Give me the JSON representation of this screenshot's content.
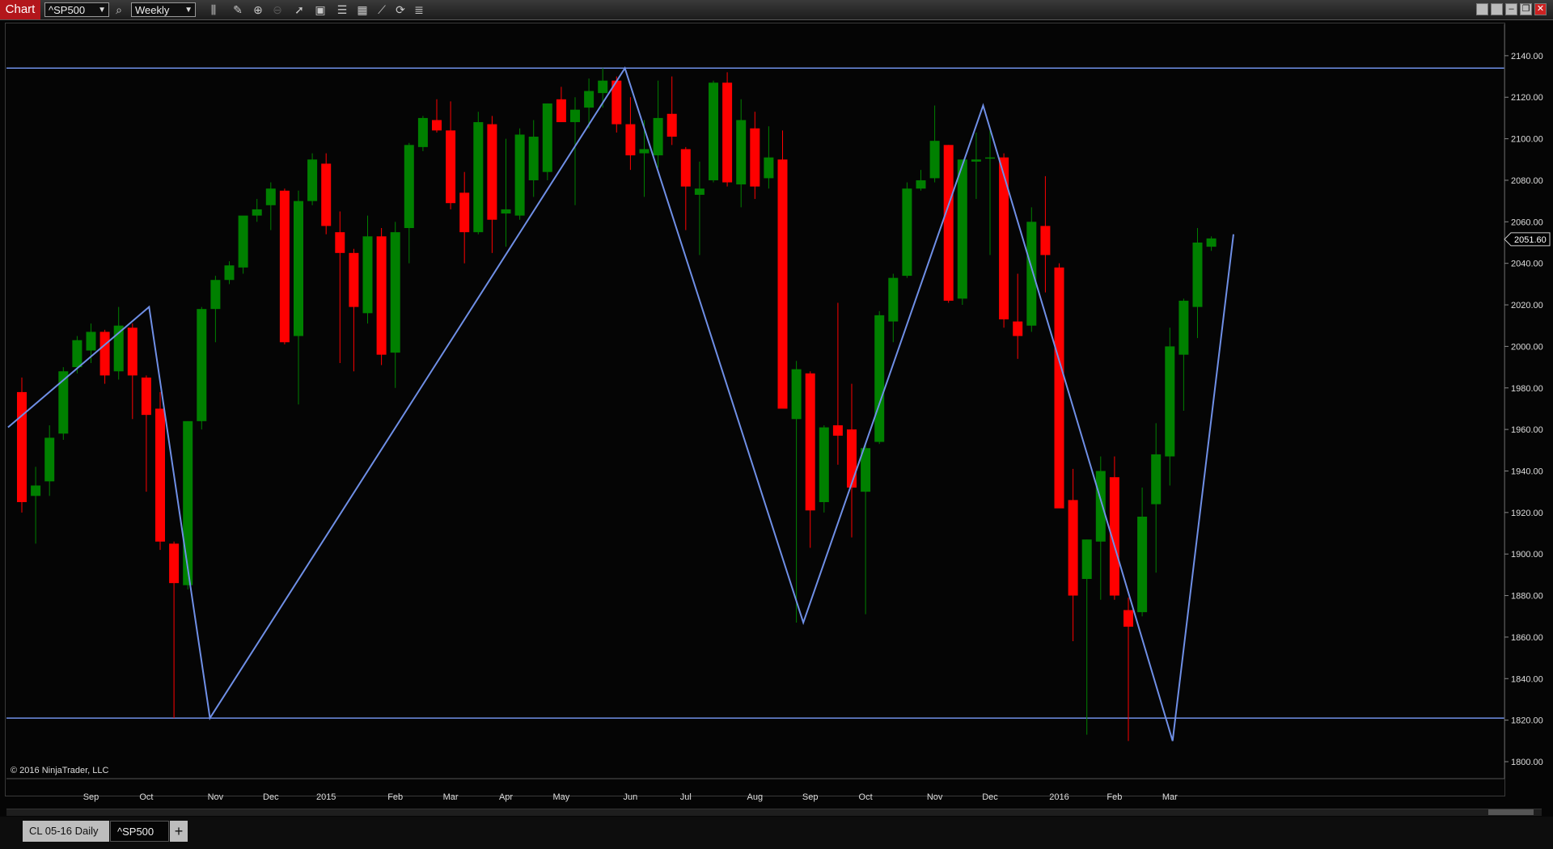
{
  "app": {
    "title": "Chart",
    "instrument": "^SP500",
    "period": "Weekly",
    "copyright": "© 2016 NinjaTrader, LLC"
  },
  "toolbar": {
    "icons": [
      "bar-type-icon",
      "pencil-icon",
      "zoom-in-icon",
      "zoom-out-icon",
      "pointer-icon",
      "properties-icon",
      "indicators-icon",
      "strategies-icon",
      "drawing-tools-icon",
      "refresh-icon",
      "data-box-icon"
    ]
  },
  "window_controls": [
    "restore-icon",
    "maximize-icon",
    "minimize-icon",
    "float-icon",
    "close-icon"
  ],
  "tabs": [
    {
      "label": "CL 05-16 Daily",
      "active": false
    },
    {
      "label": "^SP500",
      "active": true
    }
  ],
  "add_tab_label": "+",
  "chart_data": {
    "type": "candlestick",
    "y_ticks": [
      "2140.00",
      "2120.00",
      "2100.00",
      "2080.00",
      "2060.00",
      "2040.00",
      "2020.00",
      "2000.00",
      "1980.00",
      "1960.00",
      "1940.00",
      "1920.00",
      "1900.00",
      "1880.00",
      "1860.00",
      "1840.00",
      "1820.00",
      "1800.00"
    ],
    "ylim": [
      1790,
      2150
    ],
    "x_labels": [
      {
        "label": "Sep",
        "i": 5
      },
      {
        "label": "Oct",
        "i": 9
      },
      {
        "label": "Nov",
        "i": 14
      },
      {
        "label": "Dec",
        "i": 18
      },
      {
        "label": "2015",
        "i": 22
      },
      {
        "label": "Feb",
        "i": 27
      },
      {
        "label": "Mar",
        "i": 31
      },
      {
        "label": "Apr",
        "i": 35
      },
      {
        "label": "May",
        "i": 39
      },
      {
        "label": "Jun",
        "i": 44
      },
      {
        "label": "Jul",
        "i": 48
      },
      {
        "label": "Aug",
        "i": 53
      },
      {
        "label": "Sep",
        "i": 57
      },
      {
        "label": "Oct",
        "i": 61
      },
      {
        "label": "Nov",
        "i": 66
      },
      {
        "label": "Dec",
        "i": 70
      },
      {
        "label": "2016",
        "i": 75
      },
      {
        "label": "Feb",
        "i": 79
      },
      {
        "label": "Mar",
        "i": 83
      }
    ],
    "last_price": "2051.60",
    "colors": {
      "up": "#008000",
      "down": "#ff0000",
      "zigzag": "#6f8fe6",
      "background": "#050505",
      "axis_text": "#dddddd"
    },
    "candles": [
      {
        "o": 1978,
        "h": 1985,
        "l": 1920,
        "c": 1925
      },
      {
        "o": 1928,
        "h": 1942,
        "l": 1905,
        "c": 1933
      },
      {
        "o": 1935,
        "h": 1962,
        "l": 1928,
        "c": 1956
      },
      {
        "o": 1958,
        "h": 1990,
        "l": 1955,
        "c": 1988
      },
      {
        "o": 1990,
        "h": 2005,
        "l": 1987,
        "c": 2003
      },
      {
        "o": 1998,
        "h": 2011,
        "l": 1992,
        "c": 2007
      },
      {
        "o": 2007,
        "h": 2008,
        "l": 1982,
        "c": 1986
      },
      {
        "o": 1988,
        "h": 2019,
        "l": 1984,
        "c": 2010
      },
      {
        "o": 2009,
        "h": 2011,
        "l": 1965,
        "c": 1986
      },
      {
        "o": 1985,
        "h": 1986,
        "l": 1930,
        "c": 1967
      },
      {
        "o": 1970,
        "h": 1978,
        "l": 1902,
        "c": 1906
      },
      {
        "o": 1905,
        "h": 1906,
        "l": 1821,
        "c": 1886
      },
      {
        "o": 1885,
        "h": 1964,
        "l": 1883,
        "c": 1964
      },
      {
        "o": 1964,
        "h": 2019,
        "l": 1960,
        "c": 2018
      },
      {
        "o": 2018,
        "h": 2034,
        "l": 2002,
        "c": 2032
      },
      {
        "o": 2032,
        "h": 2041,
        "l": 2030,
        "c": 2039
      },
      {
        "o": 2038,
        "h": 2056,
        "l": 2035,
        "c": 2063
      },
      {
        "o": 2063,
        "h": 2071,
        "l": 2060,
        "c": 2066
      },
      {
        "o": 2068,
        "h": 2079,
        "l": 2056,
        "c": 2076
      },
      {
        "o": 2075,
        "h": 2076,
        "l": 2001,
        "c": 2002
      },
      {
        "o": 2005,
        "h": 2075,
        "l": 1972,
        "c": 2070
      },
      {
        "o": 2070,
        "h": 2093,
        "l": 2068,
        "c": 2090
      },
      {
        "o": 2088,
        "h": 2093,
        "l": 2054,
        "c": 2058
      },
      {
        "o": 2055,
        "h": 2065,
        "l": 1992,
        "c": 2045
      },
      {
        "o": 2045,
        "h": 2047,
        "l": 1988,
        "c": 2019
      },
      {
        "o": 2016,
        "h": 2063,
        "l": 2011,
        "c": 2053
      },
      {
        "o": 2053,
        "h": 2057,
        "l": 1991,
        "c": 1996
      },
      {
        "o": 1997,
        "h": 2060,
        "l": 1980,
        "c": 2055
      },
      {
        "o": 2057,
        "h": 2098,
        "l": 2040,
        "c": 2097
      },
      {
        "o": 2096,
        "h": 2111,
        "l": 2094,
        "c": 2110
      },
      {
        "o": 2109,
        "h": 2119,
        "l": 2103,
        "c": 2104
      },
      {
        "o": 2104,
        "h": 2118,
        "l": 2066,
        "c": 2069
      },
      {
        "o": 2074,
        "h": 2084,
        "l": 2040,
        "c": 2055
      },
      {
        "o": 2055,
        "h": 2113,
        "l": 2054,
        "c": 2108
      },
      {
        "o": 2107,
        "h": 2111,
        "l": 2045,
        "c": 2061
      },
      {
        "o": 2064,
        "h": 2100,
        "l": 2048,
        "c": 2066
      },
      {
        "o": 2063,
        "h": 2105,
        "l": 2061,
        "c": 2102
      },
      {
        "o": 2080,
        "h": 2109,
        "l": 2072,
        "c": 2101
      },
      {
        "o": 2084,
        "h": 2117,
        "l": 2080,
        "c": 2117
      },
      {
        "o": 2119,
        "h": 2125,
        "l": 2110,
        "c": 2108
      },
      {
        "o": 2108,
        "h": 2120,
        "l": 2068,
        "c": 2114
      },
      {
        "o": 2115,
        "h": 2129,
        "l": 2105,
        "c": 2123
      },
      {
        "o": 2122,
        "h": 2134,
        "l": 2115,
        "c": 2128
      },
      {
        "o": 2128,
        "h": 2130,
        "l": 2103,
        "c": 2107
      },
      {
        "o": 2107,
        "h": 2120,
        "l": 2085,
        "c": 2092
      },
      {
        "o": 2093,
        "h": 2109,
        "l": 2072,
        "c": 2095
      },
      {
        "o": 2092,
        "h": 2128,
        "l": 2086,
        "c": 2110
      },
      {
        "o": 2112,
        "h": 2130,
        "l": 2097,
        "c": 2101
      },
      {
        "o": 2095,
        "h": 2096,
        "l": 2056,
        "c": 2077
      },
      {
        "o": 2073,
        "h": 2089,
        "l": 2044,
        "c": 2076
      },
      {
        "o": 2080,
        "h": 2128,
        "l": 2079,
        "c": 2127
      },
      {
        "o": 2127,
        "h": 2132,
        "l": 2077,
        "c": 2079
      },
      {
        "o": 2078,
        "h": 2119,
        "l": 2067,
        "c": 2109
      },
      {
        "o": 2105,
        "h": 2113,
        "l": 2071,
        "c": 2077
      },
      {
        "o": 2081,
        "h": 2106,
        "l": 2076,
        "c": 2091
      },
      {
        "o": 2090,
        "h": 2104,
        "l": 2040,
        "c": 1970
      },
      {
        "o": 1965,
        "h": 1993,
        "l": 1867,
        "c": 1989
      },
      {
        "o": 1987,
        "h": 1988,
        "l": 1903,
        "c": 1921
      },
      {
        "o": 1925,
        "h": 1962,
        "l": 1920,
        "c": 1961
      },
      {
        "o": 1962,
        "h": 2021,
        "l": 1943,
        "c": 1957
      },
      {
        "o": 1960,
        "h": 1982,
        "l": 1908,
        "c": 1932
      },
      {
        "o": 1930,
        "h": 1953,
        "l": 1871,
        "c": 1951
      },
      {
        "o": 1954,
        "h": 2017,
        "l": 1953,
        "c": 2015
      },
      {
        "o": 2012,
        "h": 2035,
        "l": 2002,
        "c": 2033
      },
      {
        "o": 2034,
        "h": 2079,
        "l": 2033,
        "c": 2076
      },
      {
        "o": 2076,
        "h": 2085,
        "l": 2075,
        "c": 2080
      },
      {
        "o": 2081,
        "h": 2116,
        "l": 2079,
        "c": 2099
      },
      {
        "o": 2097,
        "h": 2097,
        "l": 2021,
        "c": 2022
      },
      {
        "o": 2023,
        "h": 2090,
        "l": 2020,
        "c": 2090
      },
      {
        "o": 2089,
        "h": 2103,
        "l": 2071,
        "c": 2090
      },
      {
        "o": 2091,
        "h": 2104,
        "l": 2044,
        "c": 2091
      },
      {
        "o": 2091,
        "h": 2093,
        "l": 2009,
        "c": 2013
      },
      {
        "o": 2012,
        "h": 2035,
        "l": 1994,
        "c": 2005
      },
      {
        "o": 2010,
        "h": 2067,
        "l": 2007,
        "c": 2060
      },
      {
        "o": 2058,
        "h": 2082,
        "l": 2026,
        "c": 2044
      },
      {
        "o": 2038,
        "h": 2040,
        "l": 1939,
        "c": 1922
      },
      {
        "o": 1926,
        "h": 1941,
        "l": 1858,
        "c": 1880
      },
      {
        "o": 1888,
        "h": 1907,
        "l": 1813,
        "c": 1907
      },
      {
        "o": 1906,
        "h": 1947,
        "l": 1878,
        "c": 1940
      },
      {
        "o": 1937,
        "h": 1947,
        "l": 1878,
        "c": 1880
      },
      {
        "o": 1873,
        "h": 1879,
        "l": 1810,
        "c": 1865
      },
      {
        "o": 1872,
        "h": 1932,
        "l": 1870,
        "c": 1918
      },
      {
        "o": 1924,
        "h": 1963,
        "l": 1891,
        "c": 1948
      },
      {
        "o": 1947,
        "h": 2009,
        "l": 1933,
        "c": 2000
      },
      {
        "o": 1996,
        "h": 2023,
        "l": 1969,
        "c": 2022
      },
      {
        "o": 2019,
        "h": 2057,
        "l": 2004,
        "c": 2050
      },
      {
        "o": 2048,
        "h": 2053,
        "l": 2046,
        "c": 2052
      }
    ],
    "zigzag": [
      {
        "i": -1,
        "v": 1961
      },
      {
        "i": 9.2,
        "v": 2019
      },
      {
        "i": 13.6,
        "v": 1821
      },
      {
        "i": 43.6,
        "v": 2134
      },
      {
        "i": 56.5,
        "v": 1867
      },
      {
        "i": 69.5,
        "v": 2116
      },
      {
        "i": 83.2,
        "v": 1810
      },
      {
        "i": 87.6,
        "v": 2054
      }
    ],
    "hlines": [
      2134,
      1821
    ]
  }
}
